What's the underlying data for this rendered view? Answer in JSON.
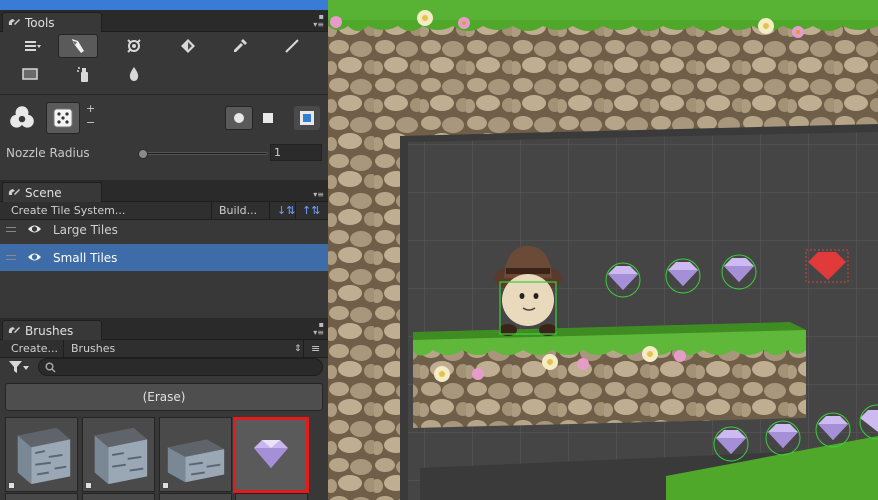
{
  "tools_panel": {
    "title": "Tools",
    "nozzle_label": "Nozzle Radius",
    "nozzle_value": "1",
    "nozzle_level": 0.0,
    "plus_label": "+",
    "minus_label": "−",
    "tools": [
      "menu-icon",
      "paint-brush-icon",
      "randomize-icon",
      "fill-bucket-icon",
      "eyedropper-icon",
      "line-icon",
      "rectangle-icon",
      "spray-icon",
      "drop-icon"
    ],
    "active_tool": "paint-brush-icon"
  },
  "scene_panel": {
    "title": "Scene",
    "toolbar": {
      "create": "Create Tile System...",
      "build": "Build..."
    },
    "tile_systems": [
      {
        "name": "Large Tiles",
        "selected": false
      },
      {
        "name": "Small Tiles",
        "selected": true
      }
    ]
  },
  "brushes_panel": {
    "title": "Brushes",
    "toolbar": {
      "create": "Create...",
      "category": "Brushes"
    },
    "search_placeholder": "",
    "erase_label": "(Erase)",
    "brushes": [
      "stone-block-brush",
      "stone-block-brush-2",
      "stone-block-brush-3",
      "purple-gem-brush"
    ],
    "selected_brush": "purple-gem-brush"
  },
  "colors": {
    "selection_blue": "#3d6ca8",
    "header_blue": "#3a7bd5",
    "highlight_red": "#e51a1a",
    "grass_green": "#4fa82a",
    "panel_dark": "#383838"
  }
}
